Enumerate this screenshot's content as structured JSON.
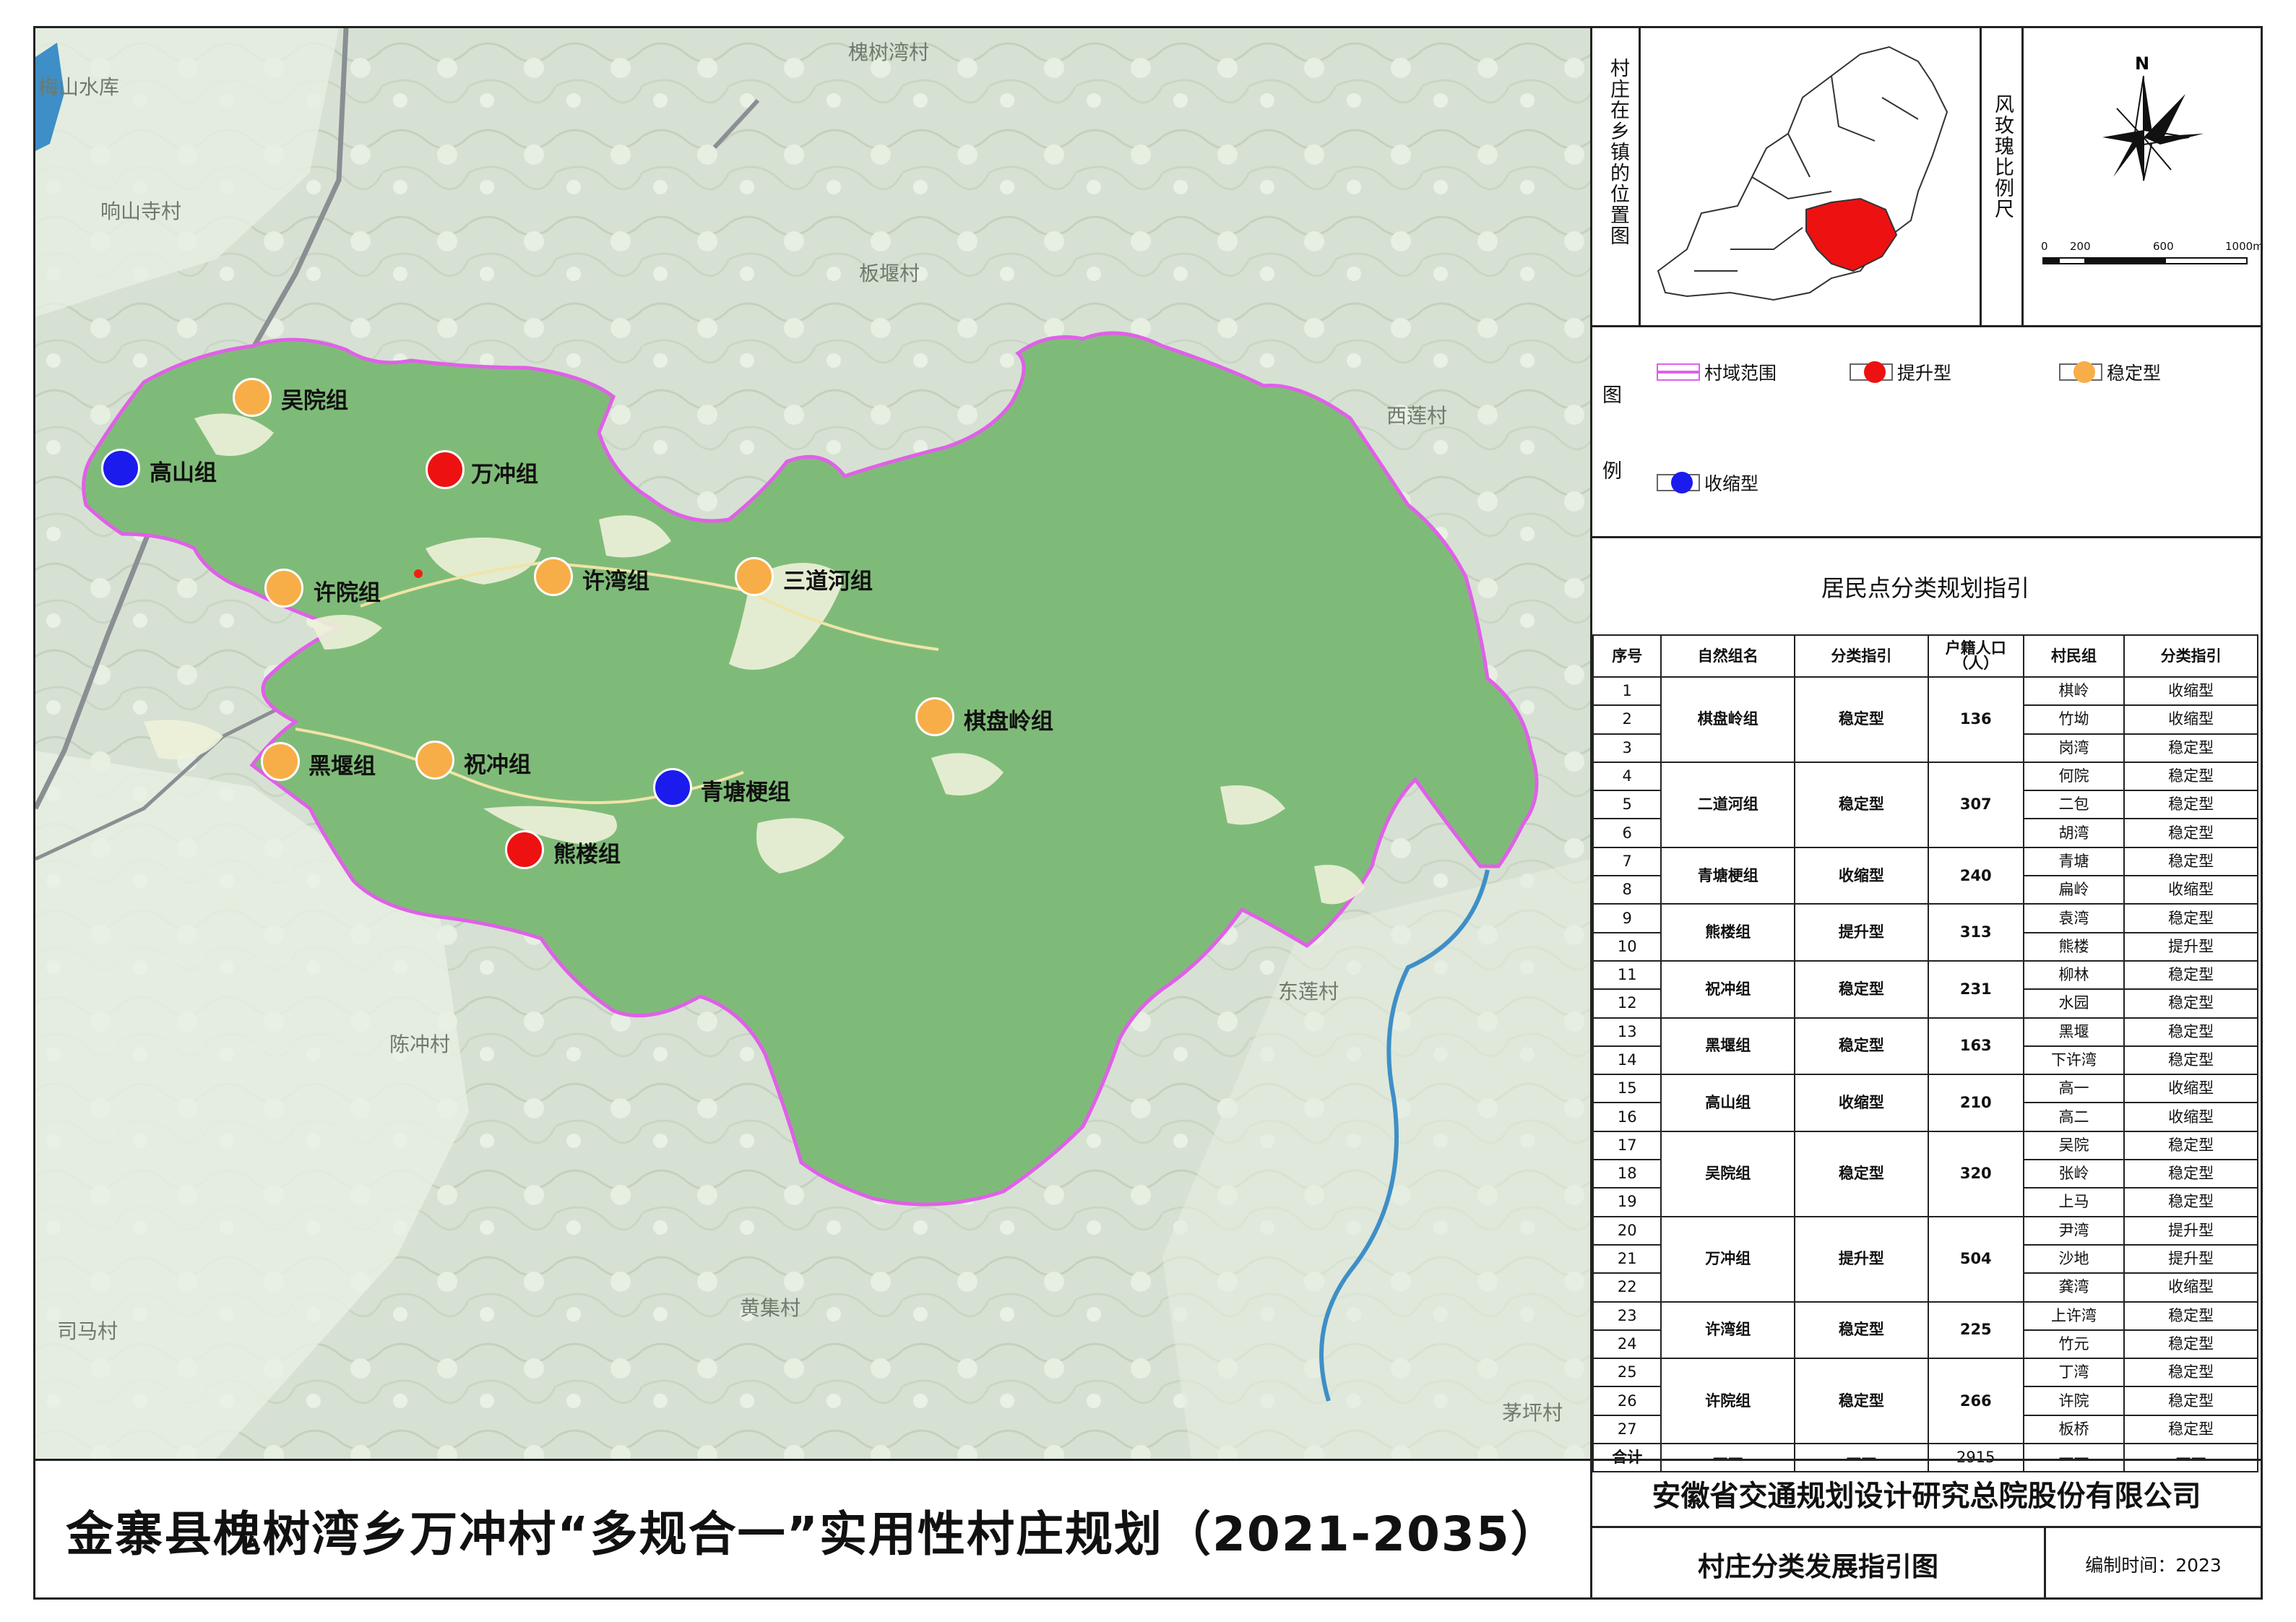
{
  "colors": {
    "upgrade": "#ee1111",
    "stable": "#f8ae48",
    "shrink": "#1b1bee",
    "boundary": "#e060e8",
    "village_fill": "#7fbb78",
    "water": "#3e8fc7"
  },
  "map": {
    "neighbors": [
      "槐树湾村",
      "梅山水库",
      "响山寺村",
      "板堰村",
      "西莲村",
      "东莲村",
      "陈冲村",
      "黄集村",
      "司马村",
      "茅坪村"
    ],
    "groups": [
      {
        "name": "吴院组",
        "type": "stable"
      },
      {
        "name": "高山组",
        "type": "shrink"
      },
      {
        "name": "万冲组",
        "type": "upgrade"
      },
      {
        "name": "许院组",
        "type": "stable"
      },
      {
        "name": "许湾组",
        "type": "stable"
      },
      {
        "name": "三道河组",
        "type": "stable"
      },
      {
        "name": "棋盘岭组",
        "type": "stable"
      },
      {
        "name": "黑堰组",
        "type": "stable"
      },
      {
        "name": "祝冲组",
        "type": "stable"
      },
      {
        "name": "青塘梗组",
        "type": "shrink"
      },
      {
        "name": "熊楼组",
        "type": "upgrade"
      }
    ]
  },
  "locator": {
    "label": "村庄在乡镇的位置图"
  },
  "compass": {
    "label": "风玫瑰比例尺",
    "north": "N",
    "scale": [
      "0",
      "200",
      "600",
      "1000m"
    ]
  },
  "legend": {
    "label_1": "图",
    "label_2": "例",
    "items": [
      {
        "label": "村域范围",
        "kind": "boundary"
      },
      {
        "label": "提升型",
        "kind": "upgrade"
      },
      {
        "label": "稳定型",
        "kind": "stable"
      },
      {
        "label": "收缩型",
        "kind": "shrink"
      }
    ]
  },
  "table": {
    "title": "居民点分类规划指引",
    "headers": [
      "序号",
      "自然组名",
      "分类指引",
      "户籍人口（人）",
      "村民组",
      "分类指引"
    ],
    "groups": [
      {
        "name": "棋盘岭组",
        "type": "稳定型",
        "pop": "136",
        "rows": [
          [
            "1",
            "棋岭",
            "收缩型"
          ],
          [
            "2",
            "竹坳",
            "收缩型"
          ],
          [
            "3",
            "岗湾",
            "稳定型"
          ]
        ]
      },
      {
        "name": "二道河组",
        "type": "稳定型",
        "pop": "307",
        "rows": [
          [
            "4",
            "何院",
            "稳定型"
          ],
          [
            "5",
            "二包",
            "稳定型"
          ],
          [
            "6",
            "胡湾",
            "稳定型"
          ]
        ]
      },
      {
        "name": "青塘梗组",
        "type": "收缩型",
        "pop": "240",
        "rows": [
          [
            "7",
            "青塘",
            "稳定型"
          ],
          [
            "8",
            "扁岭",
            "收缩型"
          ]
        ]
      },
      {
        "name": "熊楼组",
        "type": "提升型",
        "pop": "313",
        "rows": [
          [
            "9",
            "袁湾",
            "稳定型"
          ],
          [
            "10",
            "熊楼",
            "提升型"
          ]
        ]
      },
      {
        "name": "祝冲组",
        "type": "稳定型",
        "pop": "231",
        "rows": [
          [
            "11",
            "柳林",
            "稳定型"
          ],
          [
            "12",
            "水园",
            "稳定型"
          ]
        ]
      },
      {
        "name": "黑堰组",
        "type": "稳定型",
        "pop": "163",
        "rows": [
          [
            "13",
            "黑堰",
            "稳定型"
          ],
          [
            "14",
            "下许湾",
            "稳定型"
          ]
        ]
      },
      {
        "name": "高山组",
        "type": "收缩型",
        "pop": "210",
        "rows": [
          [
            "15",
            "高一",
            "收缩型"
          ],
          [
            "16",
            "高二",
            "收缩型"
          ]
        ]
      },
      {
        "name": "吴院组",
        "type": "稳定型",
        "pop": "320",
        "rows": [
          [
            "17",
            "吴院",
            "稳定型"
          ],
          [
            "18",
            "张岭",
            "稳定型"
          ],
          [
            "19",
            "上马",
            "稳定型"
          ]
        ]
      },
      {
        "name": "万冲组",
        "type": "提升型",
        "pop": "504",
        "rows": [
          [
            "20",
            "尹湾",
            "提升型"
          ],
          [
            "21",
            "沙地",
            "提升型"
          ],
          [
            "22",
            "龚湾",
            "收缩型"
          ]
        ]
      },
      {
        "name": "许湾组",
        "type": "稳定型",
        "pop": "225",
        "rows": [
          [
            "23",
            "上许湾",
            "稳定型"
          ],
          [
            "24",
            "竹元",
            "稳定型"
          ]
        ]
      },
      {
        "name": "许院组",
        "type": "稳定型",
        "pop": "266",
        "rows": [
          [
            "25",
            "丁湾",
            "稳定型"
          ],
          [
            "26",
            "许院",
            "稳定型"
          ],
          [
            "27",
            "板桥",
            "稳定型"
          ]
        ]
      }
    ],
    "total": {
      "label": "合计",
      "dash": "——",
      "pop": "2915"
    }
  },
  "title": "金寨县槐树湾乡万冲村“多规合一”实用性村庄规划（2021-2035）",
  "company": "安徽省交通规划设计研究总院股份有限公司",
  "subtitle": "村庄分类发展指引图",
  "date": "编制时间：2023"
}
